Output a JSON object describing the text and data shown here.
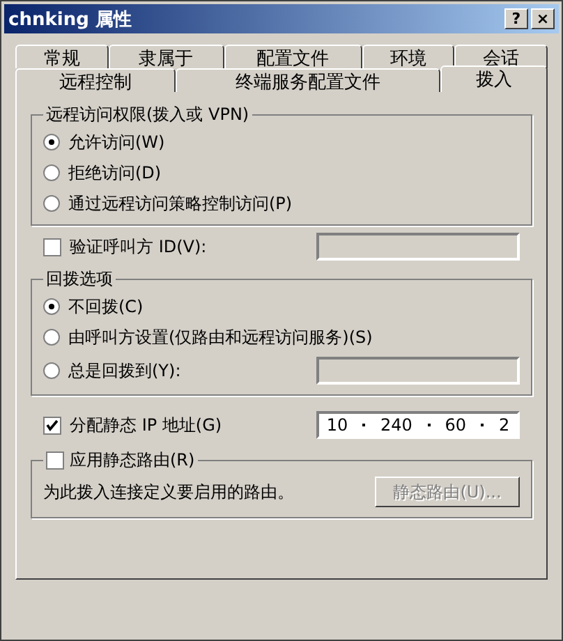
{
  "window": {
    "title": "chnking 属性",
    "title_buttons": [
      "?",
      "×"
    ]
  },
  "tab_rows": [
    [
      {
        "label": "常规",
        "selected": false
      },
      {
        "label": "隶属于",
        "selected": false
      },
      {
        "label": "配置文件",
        "selected": false
      },
      {
        "label": "环境",
        "selected": false
      },
      {
        "label": "会话",
        "selected": false
      }
    ],
    [
      {
        "label": "远程控制",
        "selected": false
      },
      {
        "label": "终端服务配置文件",
        "selected": false
      },
      {
        "label": "拨入",
        "selected": true
      }
    ]
  ],
  "access_group": {
    "title": "远程访问权限(拨入或 VPN)",
    "options": [
      {
        "label": "允许访问(W)",
        "selected": true
      },
      {
        "label": "拒绝访问(D)",
        "selected": false
      },
      {
        "label": "通过远程访问策略控制访问(P)",
        "selected": false
      }
    ]
  },
  "verify_caller": {
    "label": "验证呼叫方 ID(V):",
    "checked": false,
    "field_disabled": true
  },
  "callback_group": {
    "title": "回拨选项",
    "options": [
      {
        "label": "不回拨(C)",
        "selected": true,
        "field": false
      },
      {
        "label": "由呼叫方设置(仅路由和远程访问服务)(S)",
        "selected": false,
        "field": false
      },
      {
        "label": "总是回拨到(Y):",
        "selected": false,
        "field": true
      }
    ]
  },
  "static_ip": {
    "label": "分配静态 IP 地址(G)",
    "checked": true,
    "octets": [
      "10",
      "240",
      "60",
      "2"
    ]
  },
  "static_routes": {
    "label": "应用静态路由(R)",
    "checked": false,
    "description": "为此拨入连接定义要启用的路由。",
    "button": {
      "label": "静态路由(U)...",
      "disabled": true
    }
  }
}
